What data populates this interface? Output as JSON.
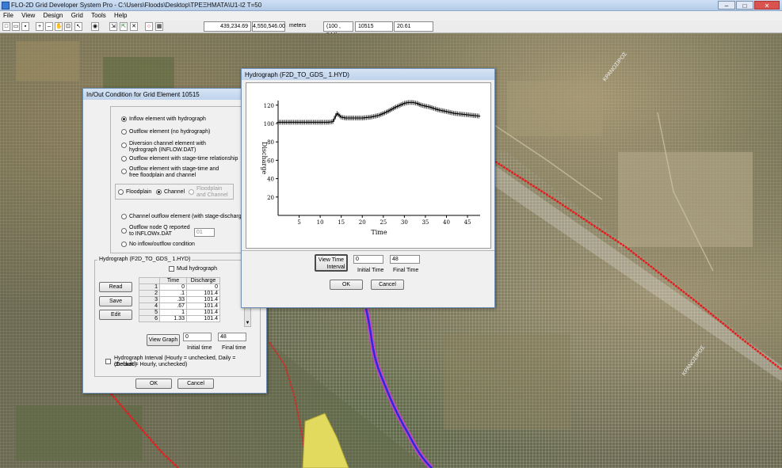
{
  "app": {
    "title": "FLO-2D Grid Developer System Pro - C:\\Users\\Floods\\Desktop\\ΤΡΕΞΗΜΑΤΑ\\U1-I2 T=50",
    "minimize": "–",
    "maximize": "□",
    "close": "✕"
  },
  "menu": [
    "File",
    "View",
    "Design",
    "Grid",
    "Tools",
    "Help"
  ],
  "toolbar": {
    "x_coord": "439,234.69",
    "y_coord": "4,550,546.00",
    "units": "meters",
    "cell": "(100 , 544)",
    "element": "10515",
    "value": "20.61"
  },
  "map": {
    "labels": [
      "ΚΡΑΝΟΣΙΡΟΣ",
      "ΚΡΑΝΟΣΙΡΟΣ"
    ],
    "colors": {
      "boundary": "#e02020",
      "river": "#2a2ad8",
      "channel": "#d040d0",
      "inflow_area": "#e8e060"
    }
  },
  "inout_dialog": {
    "title": "In/Out Condition for Grid Element 10515",
    "options": [
      "Inflow element with hydrograph",
      "Outflow element (no hydrograph)",
      "Diversion channel element with hydrograph (INFLOW.DAT)",
      "Outflow element with stage-time relationship",
      "Outflow element with stage-time and free floodplain and channel"
    ],
    "location": [
      "Floodplain",
      "Channel",
      "Floodplain and Channel"
    ],
    "outflow_options": [
      "Channel outflow element (with stage-discharge)",
      "Outflow node Q reported to INFLOWx.DAT",
      "No inflow/outflow condition"
    ],
    "node_select": "01",
    "hydrograph_group": "Hydrograph (F2D_TO_GDS_ 1.HYD)",
    "mud_hydrograph": "Mud hydrograph",
    "read": "Read",
    "save": "Save",
    "edit": "Edit",
    "columns": [
      "Time",
      "Discharge"
    ],
    "rows": [
      [
        "1",
        "0",
        "0"
      ],
      [
        "2",
        ".1",
        "101.4"
      ],
      [
        "3",
        ".33",
        "101.4"
      ],
      [
        "4",
        ".67",
        "101.4"
      ],
      [
        "5",
        "1",
        "101.4"
      ],
      [
        "6",
        "1.33",
        "101.4"
      ]
    ],
    "view_graph": "View Graph",
    "initial_time_value": "0",
    "final_time_value": "48",
    "initial_time_label": "Initial time",
    "final_time_label": "Final time",
    "interval_note_1": "Hydrograph Interval (Hourly = unchecked, Daily = checked)",
    "interval_note_2": "(Default = Hourly, unchecked)",
    "ok": "OK",
    "cancel": "Cancel"
  },
  "hydro_dialog": {
    "title": "Hydrograph (F2D_TO_GDS_ 1.HYD)",
    "view_time_interval_1": "View Time",
    "view_time_interval_2": "Interval",
    "initial_time_value": "0",
    "final_time_value": "48",
    "initial_time_label": "Initial Time",
    "final_time_label": "Final Time",
    "ok": "OK",
    "cancel": "Cancel"
  },
  "chart_data": {
    "type": "line",
    "xlabel": "Time",
    "ylabel": "Discharge",
    "xlim": [
      0,
      48
    ],
    "ylim": [
      0,
      125
    ],
    "xticks": [
      5,
      10,
      15,
      20,
      25,
      30,
      35,
      40,
      45
    ],
    "yticks": [
      20,
      40,
      60,
      80,
      100,
      120
    ],
    "grid": false,
    "x": [
      0,
      2,
      4,
      6,
      8,
      10,
      12,
      13,
      14,
      15,
      16,
      17,
      18,
      20,
      22,
      24,
      26,
      28,
      30,
      31,
      32,
      33,
      34,
      36,
      38,
      40,
      42,
      44,
      46,
      48
    ],
    "values": [
      101.4,
      101.4,
      101.4,
      101.4,
      101.4,
      101.4,
      101.4,
      102,
      111,
      107,
      106,
      106,
      106,
      106,
      107,
      109,
      113,
      118,
      122,
      123,
      123,
      122,
      120,
      118,
      115,
      113,
      111,
      110,
      109,
      108
    ]
  }
}
